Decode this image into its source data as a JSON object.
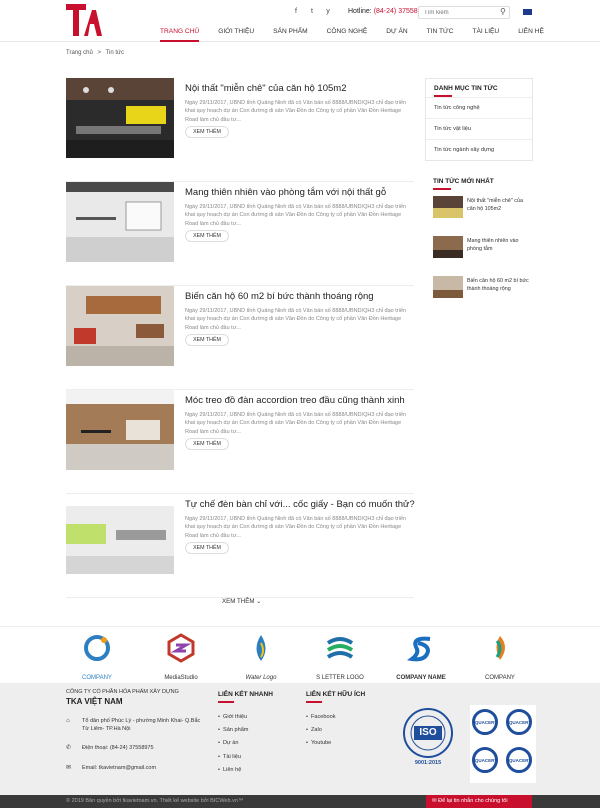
{
  "header": {
    "logo_text": "TKA",
    "hotline_label": "Hotline:",
    "hotline_number": "(84-24) 37558975",
    "search_placeholder": "Tìm kiếm",
    "social": [
      "f",
      "t",
      "y"
    ],
    "nav": [
      "Trang chủ",
      "Giới thiệu",
      "Sản phẩm",
      "Công nghệ",
      "Dự án",
      "Tin tức",
      "Tài liệu",
      "Liên hệ"
    ]
  },
  "breadcrumb": [
    "Trang chủ",
    ">",
    "Tin tức"
  ],
  "articles": [
    {
      "title": "Nội thất \"miễn chê\" của căn hộ 105m2",
      "desc": "Ngày 29/11/2017, UBND tỉnh Quảng Ninh đã có Văn bản số 8888/UBND/QH3 chỉ đạo triển khai quy hoạch dự án Con đường di sản Vân Đồn do Công ty cổ phần Vân Đồn Heritage Road làm chủ đầu tư...",
      "more": "XEM THÊM"
    },
    {
      "title": "Mang thiên nhiên vào phòng tắm với nội thất gỗ",
      "desc": "Ngày 29/11/2017, UBND tỉnh Quảng Ninh đã có Văn bản số 8888/UBND/QH3 chỉ đạo triển khai quy hoạch dự án Con đường di sản Vân Đồn do Công ty cổ phần Vân Đồn Heritage Road làm chủ đầu tư...",
      "more": "XEM THÊM"
    },
    {
      "title": "Biến căn hộ 60 m2 bí bức thành thoáng rộng",
      "desc": "Ngày 29/11/2017, UBND tỉnh Quảng Ninh đã có Văn bản số 8888/UBND/QH3 chỉ đạo triển khai quy hoạch dự án Con đường di sản Vân Đồn do Công ty cổ phần Vân Đồn Heritage Road làm chủ đầu tư...",
      "more": "XEM THÊM"
    },
    {
      "title": "Móc treo đồ đàn accordion treo đầu cũng thành xinh",
      "desc": "Ngày 29/11/2017, UBND tỉnh Quảng Ninh đã có Văn bản số 8888/UBND/QH3 chỉ đạo triển khai quy hoạch dự án Con đường di sản Vân Đồn do Công ty cổ phần Vân Đồn Heritage Road làm chủ đầu tư...",
      "more": "XEM THÊM"
    },
    {
      "title": "Tự chế đèn bàn chỉ với... cốc giấy - Bạn có muốn thử?",
      "desc": "Ngày 29/11/2017, UBND tỉnh Quảng Ninh đã có Văn bản số 8888/UBND/QH3 chỉ đạo triển khai quy hoạch dự án Con đường di sản Vân Đồn do Công ty cổ phần Vân Đồn Heritage Road làm chủ đầu tư...",
      "more": "XEM THÊM"
    }
  ],
  "load_more": "XEM THÊM ⌄",
  "sidebar": {
    "categories_title": "DANH MỤC TIN TỨC",
    "categories": [
      "Tin tức công nghệ",
      "Tin tức vật liệu",
      "Tin tức ngành xây dựng"
    ],
    "latest_title": "TIN TỨC MỚI NHẤT",
    "latest": [
      "Nội thất \"miễn chê\" của căn hộ 105m2",
      "Mang thiên nhiên vào phòng tắm",
      "Biến căn hộ 60 m2 bí bức thành thoáng rộng"
    ]
  },
  "partners": [
    "COMPANY",
    "MediaStudio",
    "Water Logo",
    "S LETTER LOGO",
    "COMPANY NAME",
    "COMPANY"
  ],
  "footer": {
    "company_line": "CÔNG TY CỔ PHẦN HÓA PHẨM XÂY DỰNG",
    "company_name": "TKA VIỆT NAM",
    "address": "Tổ dân phố Phúc Lý - phường Minh Khai- Q.Bắc Từ Liêm- TP.Hà Nội",
    "phone": "Điện thoại: (84-24) 37558975",
    "email": "Email: tkavietnam@gmail.com",
    "quick_links_title": "LIÊN KẾT NHANH",
    "quick_links": [
      "Giới thiệu",
      "Sản phẩm",
      "Dự án",
      "Tài liệu",
      "Liên hệ"
    ],
    "useful_links_title": "LIÊN KẾT HỮU ÍCH",
    "useful_links": [
      "Facebook",
      "Zalo",
      "Youtube"
    ],
    "cert_iso": "ISO",
    "cert_iso_number": "9001:2015",
    "cert_quacert": "QUACERT",
    "copyright": "© 2019 Bản quyền bởi tkavietnam.vn. Thiết kế website bởi BICWeb.vn™",
    "chat": "Để lại tin nhắn cho chúng tôi"
  },
  "colors": {
    "brand": "#c8102e"
  }
}
